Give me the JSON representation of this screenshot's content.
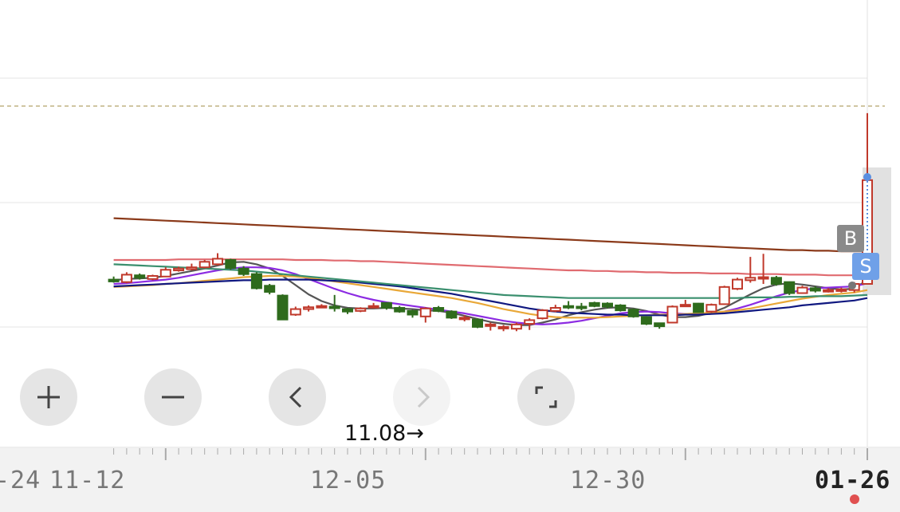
{
  "chart_data": {
    "type": "candlestick",
    "x_axis_labels": [
      "-24",
      "11-12",
      "12-05",
      "12-30",
      "01-26"
    ],
    "reference_line_dashed": "yes",
    "candles": [
      {
        "o": 22.0,
        "c": 21.7,
        "h": 22.5,
        "l": 21.5,
        "up": false
      },
      {
        "o": 21.6,
        "c": 22.8,
        "h": 23.2,
        "l": 21.4,
        "up": true
      },
      {
        "o": 22.7,
        "c": 22.3,
        "h": 23.0,
        "l": 22.0,
        "up": false
      },
      {
        "o": 22.1,
        "c": 22.6,
        "h": 22.8,
        "l": 21.9,
        "up": true
      },
      {
        "o": 22.5,
        "c": 23.6,
        "h": 24.0,
        "l": 22.4,
        "up": true
      },
      {
        "o": 23.5,
        "c": 23.8,
        "h": 24.1,
        "l": 23.3,
        "up": true
      },
      {
        "o": 23.7,
        "c": 24.0,
        "h": 24.6,
        "l": 23.5,
        "up": true
      },
      {
        "o": 24.0,
        "c": 24.9,
        "h": 25.2,
        "l": 23.8,
        "up": true
      },
      {
        "o": 24.5,
        "c": 25.4,
        "h": 26.3,
        "l": 24.3,
        "up": true
      },
      {
        "o": 25.2,
        "c": 23.9,
        "h": 25.4,
        "l": 23.6,
        "up": false
      },
      {
        "o": 23.8,
        "c": 22.9,
        "h": 24.2,
        "l": 22.6,
        "up": false
      },
      {
        "o": 22.9,
        "c": 20.6,
        "h": 23.2,
        "l": 20.4,
        "up": false
      },
      {
        "o": 21.0,
        "c": 20.0,
        "h": 21.3,
        "l": 19.6,
        "up": false
      },
      {
        "o": 19.4,
        "c": 15.5,
        "h": 19.6,
        "l": 15.4,
        "up": false
      },
      {
        "o": 16.3,
        "c": 17.2,
        "h": 17.6,
        "l": 16.1,
        "up": true
      },
      {
        "o": 17.2,
        "c": 17.5,
        "h": 17.8,
        "l": 16.8,
        "up": true
      },
      {
        "o": 17.6,
        "c": 17.7,
        "h": 18.0,
        "l": 17.4,
        "up": true
      },
      {
        "o": 17.6,
        "c": 17.4,
        "h": 19.5,
        "l": 16.8,
        "up": false
      },
      {
        "o": 17.2,
        "c": 16.8,
        "h": 17.4,
        "l": 16.4,
        "up": false
      },
      {
        "o": 16.9,
        "c": 17.3,
        "h": 17.5,
        "l": 16.7,
        "up": true
      },
      {
        "o": 17.6,
        "c": 17.7,
        "h": 18.2,
        "l": 17.3,
        "up": true
      },
      {
        "o": 18.2,
        "c": 17.4,
        "h": 18.3,
        "l": 17.1,
        "up": false
      },
      {
        "o": 17.4,
        "c": 16.8,
        "h": 17.7,
        "l": 16.6,
        "up": false
      },
      {
        "o": 16.9,
        "c": 16.3,
        "h": 17.1,
        "l": 15.8,
        "up": false
      },
      {
        "o": 16.0,
        "c": 17.3,
        "h": 17.5,
        "l": 15.0,
        "up": true
      },
      {
        "o": 17.4,
        "c": 16.9,
        "h": 17.7,
        "l": 16.7,
        "up": false
      },
      {
        "o": 16.8,
        "c": 15.8,
        "h": 17.0,
        "l": 15.6,
        "up": false
      },
      {
        "o": 15.8,
        "c": 15.8,
        "h": 16.2,
        "l": 15.2,
        "up": true
      },
      {
        "o": 15.5,
        "c": 14.3,
        "h": 15.7,
        "l": 14.1,
        "up": false
      },
      {
        "o": 14.6,
        "c": 14.7,
        "h": 15.0,
        "l": 13.7,
        "up": true
      },
      {
        "o": 14.2,
        "c": 14.3,
        "h": 14.6,
        "l": 13.6,
        "up": true
      },
      {
        "o": 14.0,
        "c": 14.7,
        "h": 15.0,
        "l": 13.6,
        "up": true
      },
      {
        "o": 14.8,
        "c": 15.4,
        "h": 15.7,
        "l": 13.8,
        "up": true
      },
      {
        "o": 15.7,
        "c": 17.0,
        "h": 17.2,
        "l": 15.5,
        "up": true
      },
      {
        "o": 16.9,
        "c": 17.4,
        "h": 17.9,
        "l": 16.7,
        "up": true
      },
      {
        "o": 17.5,
        "c": 17.7,
        "h": 18.5,
        "l": 17.2,
        "up": false
      },
      {
        "o": 17.6,
        "c": 17.4,
        "h": 18.2,
        "l": 17.0,
        "up": false
      },
      {
        "o": 18.2,
        "c": 17.7,
        "h": 18.4,
        "l": 17.5,
        "up": false
      },
      {
        "o": 18.1,
        "c": 17.6,
        "h": 18.3,
        "l": 17.3,
        "up": false
      },
      {
        "o": 17.8,
        "c": 17.0,
        "h": 18.0,
        "l": 16.8,
        "up": false
      },
      {
        "o": 17.1,
        "c": 16.0,
        "h": 17.3,
        "l": 15.8,
        "up": false
      },
      {
        "o": 15.9,
        "c": 14.8,
        "h": 16.0,
        "l": 14.6,
        "up": false
      },
      {
        "o": 14.9,
        "c": 14.4,
        "h": 15.0,
        "l": 14.0,
        "up": false
      },
      {
        "o": 15.0,
        "c": 17.6,
        "h": 17.8,
        "l": 14.9,
        "up": true
      },
      {
        "o": 17.8,
        "c": 17.9,
        "h": 18.7,
        "l": 17.6,
        "up": true
      },
      {
        "o": 18.1,
        "c": 16.7,
        "h": 18.2,
        "l": 16.6,
        "up": false
      },
      {
        "o": 16.8,
        "c": 17.9,
        "h": 18.1,
        "l": 16.6,
        "up": true
      },
      {
        "o": 18.0,
        "c": 20.8,
        "h": 21.0,
        "l": 17.9,
        "up": true
      },
      {
        "o": 20.5,
        "c": 22.0,
        "h": 22.3,
        "l": 20.3,
        "up": true
      },
      {
        "o": 21.9,
        "c": 22.3,
        "h": 25.7,
        "l": 21.5,
        "up": true
      },
      {
        "o": 22.3,
        "c": 22.4,
        "h": 26.2,
        "l": 21.3,
        "up": true
      },
      {
        "o": 22.3,
        "c": 21.3,
        "h": 22.6,
        "l": 21.0,
        "up": false
      },
      {
        "o": 21.6,
        "c": 19.8,
        "h": 21.7,
        "l": 19.5,
        "up": false
      },
      {
        "o": 19.8,
        "c": 20.7,
        "h": 21.0,
        "l": 19.7,
        "up": true
      },
      {
        "o": 20.6,
        "c": 20.2,
        "h": 20.9,
        "l": 19.9,
        "up": false
      },
      {
        "o": 20.2,
        "c": 20.3,
        "h": 20.6,
        "l": 19.9,
        "up": true
      },
      {
        "o": 20.2,
        "c": 20.4,
        "h": 20.7,
        "l": 19.9,
        "up": true
      },
      {
        "o": 20.3,
        "c": 21.3,
        "h": 21.6,
        "l": 19.9,
        "up": true
      },
      {
        "o": 21.3,
        "c": 38.2,
        "h": 49.1,
        "l": 21.3,
        "up": true
      }
    ],
    "ma_lines": [
      {
        "color": "#555555",
        "values": [
          21.9,
          22.1,
          22.2,
          22.3,
          22.6,
          23.0,
          23.4,
          23.8,
          24.3,
          24.8,
          24.9,
          24.5,
          23.8,
          22.6,
          21.1,
          19.6,
          18.5,
          17.8,
          17.4,
          17.3,
          17.3,
          17.4,
          17.3,
          17.2,
          17.0,
          16.9,
          16.6,
          16.1,
          15.6,
          15.1,
          14.8,
          14.6,
          14.6,
          15.0,
          15.5,
          16.2,
          16.7,
          17.1,
          17.4,
          17.5,
          17.3,
          16.9,
          16.3,
          15.9,
          15.9,
          16.1,
          16.6,
          17.4,
          18.5,
          19.6,
          20.6,
          21.2,
          21.4,
          21.2,
          20.9,
          20.6,
          20.4,
          20.5,
          22.0
        ]
      },
      {
        "color": "#8c2be2",
        "values": [
          21.3,
          21.4,
          21.6,
          21.8,
          22.0,
          22.3,
          22.7,
          23.1,
          23.5,
          23.8,
          24.0,
          24.0,
          23.9,
          23.5,
          22.9,
          22.1,
          21.3,
          20.5,
          19.8,
          19.2,
          18.7,
          18.3,
          18.0,
          17.7,
          17.4,
          17.1,
          16.8,
          16.5,
          16.1,
          15.7,
          15.3,
          15.0,
          14.8,
          14.7,
          14.8,
          15.0,
          15.3,
          15.7,
          16.1,
          16.5,
          16.7,
          16.8,
          16.7,
          16.5,
          16.4,
          16.4,
          16.5,
          16.8,
          17.3,
          17.9,
          18.6,
          19.3,
          19.9,
          20.3,
          20.6,
          20.7,
          20.8,
          20.9,
          21.4
        ]
      },
      {
        "color": "#e9a838",
        "values": [
          20.8,
          20.9,
          21.0,
          21.1,
          21.3,
          21.4,
          21.6,
          21.8,
          22.0,
          22.2,
          22.4,
          22.5,
          22.6,
          22.6,
          22.5,
          22.3,
          22.0,
          21.7,
          21.4,
          21.1,
          20.8,
          20.5,
          20.2,
          19.9,
          19.6,
          19.3,
          19.0,
          18.6,
          18.2,
          17.7,
          17.2,
          16.8,
          16.4,
          16.1,
          15.9,
          15.8,
          15.8,
          15.8,
          15.9,
          16.0,
          16.1,
          16.2,
          16.3,
          16.3,
          16.4,
          16.5,
          16.6,
          16.8,
          17.0,
          17.3,
          17.7,
          18.1,
          18.5,
          18.9,
          19.2,
          19.5,
          19.7,
          19.9,
          20.3
        ]
      },
      {
        "color": "#101880",
        "values": [
          20.9,
          21.0,
          21.1,
          21.2,
          21.3,
          21.4,
          21.5,
          21.6,
          21.7,
          21.8,
          21.9,
          21.9,
          22.0,
          22.0,
          22.0,
          22.0,
          21.9,
          21.8,
          21.7,
          21.5,
          21.3,
          21.1,
          20.9,
          20.6,
          20.3,
          20.0,
          19.7,
          19.3,
          18.9,
          18.5,
          18.1,
          17.7,
          17.3,
          17.0,
          16.8,
          16.6,
          16.5,
          16.4,
          16.3,
          16.3,
          16.2,
          16.2,
          16.2,
          16.2,
          16.3,
          16.3,
          16.4,
          16.5,
          16.7,
          16.9,
          17.1,
          17.3,
          17.5,
          17.8,
          18.0,
          18.2,
          18.4,
          18.6,
          19.0
        ]
      },
      {
        "color": "#3a8f6e",
        "values": [
          24.5,
          24.4,
          24.3,
          24.2,
          24.1,
          24.0,
          23.9,
          23.8,
          23.7,
          23.6,
          23.5,
          23.3,
          23.1,
          22.9,
          22.7,
          22.5,
          22.3,
          22.1,
          21.9,
          21.7,
          21.5,
          21.3,
          21.1,
          20.9,
          20.7,
          20.5,
          20.3,
          20.1,
          19.9,
          19.7,
          19.5,
          19.4,
          19.3,
          19.2,
          19.1,
          19.0,
          19.0,
          19.0,
          19.0,
          19.0,
          19.0,
          19.0,
          19.0,
          19.0,
          19.0,
          19.0,
          19.0,
          19.0,
          19.0,
          19.1,
          19.1,
          19.1,
          19.2,
          19.2,
          19.3,
          19.3,
          19.3,
          19.4,
          19.5
        ]
      },
      {
        "color": "#e06b70",
        "values": [
          25.2,
          25.2,
          25.2,
          25.2,
          25.2,
          25.3,
          25.3,
          25.3,
          25.3,
          25.3,
          25.3,
          25.3,
          25.3,
          25.3,
          25.2,
          25.2,
          25.2,
          25.1,
          25.1,
          25.0,
          25.0,
          24.9,
          24.8,
          24.7,
          24.6,
          24.5,
          24.4,
          24.3,
          24.2,
          24.1,
          24.0,
          23.9,
          23.8,
          23.7,
          23.6,
          23.5,
          23.5,
          23.4,
          23.4,
          23.3,
          23.3,
          23.2,
          23.2,
          23.1,
          23.1,
          23.1,
          23.0,
          23.0,
          23.0,
          22.9,
          22.9,
          22.9,
          22.8,
          22.8,
          22.8,
          22.7,
          22.7,
          22.7,
          22.8
        ]
      },
      {
        "color": "#8b3a1a",
        "values": [
          32.0,
          31.9,
          31.8,
          31.7,
          31.6,
          31.5,
          31.4,
          31.3,
          31.2,
          31.1,
          31.0,
          30.9,
          30.8,
          30.7,
          30.6,
          30.5,
          30.4,
          30.3,
          30.2,
          30.1,
          30.0,
          29.9,
          29.8,
          29.7,
          29.6,
          29.5,
          29.4,
          29.3,
          29.2,
          29.1,
          29.0,
          28.9,
          28.8,
          28.7,
          28.6,
          28.5,
          28.4,
          28.3,
          28.2,
          28.1,
          28.0,
          27.9,
          27.8,
          27.7,
          27.6,
          27.5,
          27.4,
          27.3,
          27.2,
          27.1,
          27.0,
          26.9,
          26.8,
          26.8,
          26.7,
          26.7,
          26.6,
          26.6,
          26.6
        ]
      }
    ]
  },
  "controls": {
    "zoom_in_icon": "plus-icon",
    "zoom_out_icon": "minus-icon",
    "prev_icon": "chevron-left-icon",
    "next_icon": "chevron-right-icon",
    "fullscreen_icon": "fullscreen-icon"
  },
  "nav_hint": "11.08→",
  "markers": {
    "buy": "B",
    "sell": "S"
  },
  "colors": {
    "up": "#c0392b",
    "down": "#2e6b1c",
    "dashed_line": "#b5a56a"
  }
}
